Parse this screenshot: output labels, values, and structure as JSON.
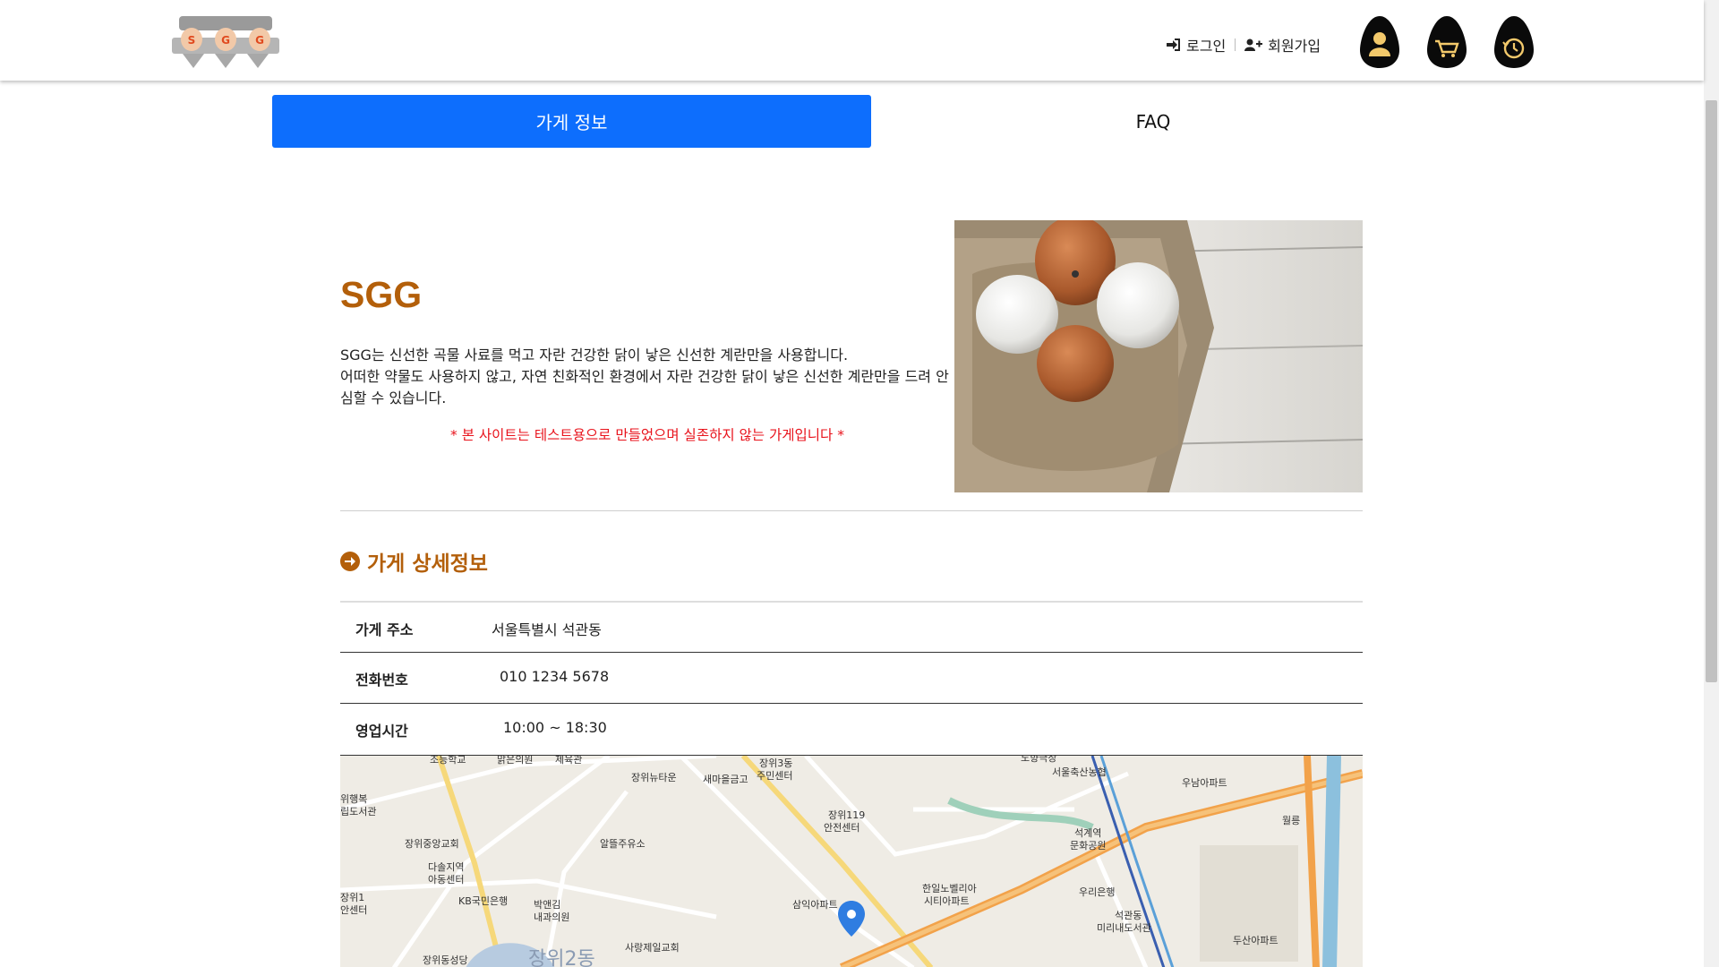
{
  "header": {
    "logo_letters": [
      "S",
      "G",
      "G"
    ],
    "login_label": "로그인",
    "signup_label": "회원가입",
    "icons": [
      "user-egg-icon",
      "cart-egg-icon",
      "history-egg-icon"
    ]
  },
  "tabs": [
    {
      "label": "가게 정보",
      "active": true
    },
    {
      "label": "FAQ",
      "active": false
    }
  ],
  "store": {
    "name": "SGG",
    "description_line1": "SGG는 신선한 곡물 사료를 먹고 자란 건강한 닭이 낳은 신선한 계란만을 사용합니다.",
    "description_line2": "어떠한 약물도 사용하지 않고, 자연 친화적인 환경에서 자란 건강한 닭이 낳은 신선한 계란만을 드려 안심할 수 있습니다.",
    "notice": "* 본 사이트는 테스트용으로 만들었으며 실존하지 않는 가게입니다 *"
  },
  "details": {
    "title": "가게 상세정보",
    "rows": [
      {
        "label": "가게 주소",
        "value": "서울특별시 석관동"
      },
      {
        "label": "전화번호",
        "value": "010 1234 5678"
      },
      {
        "label": "영업시간",
        "value": "10:00 ~ 18:30"
      }
    ]
  },
  "map_labels": [
    "조등학교",
    "맑은의원",
    "제육관",
    "장위뉴타운",
    "새마을금고",
    "장위3동",
    "주민센터",
    "노향극장",
    "서울축산농협",
    "우남아파트",
    "위행복",
    "립도서관",
    "장위중앙교회",
    "알뜰주유소",
    "장위119",
    "안전센터",
    "석계역",
    "문화공원",
    "월릉",
    "다솔지역",
    "아동센터",
    "장위1",
    "안센터",
    "KB국민은행",
    "박앤김",
    "내과의원",
    "삼익아파트",
    "한일노벨리아",
    "시티아파트",
    "우리은행",
    "석관동",
    "미리내도서관",
    "두산아파트",
    "사랑제일교회",
    "장위동성당",
    "장위2동"
  ],
  "colors": {
    "accent": "#0d6efd",
    "brand": "#b35f0a",
    "notice": "#e8121b"
  }
}
